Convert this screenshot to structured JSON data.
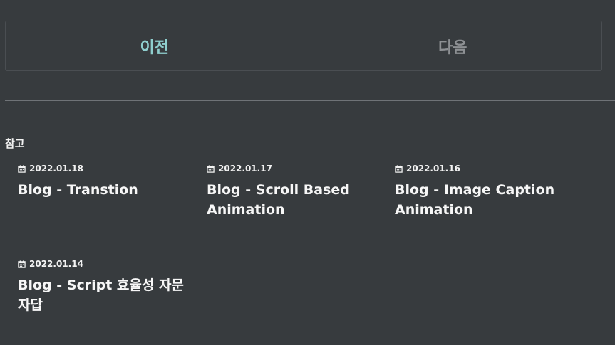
{
  "pager": {
    "prev_label": "이전",
    "next_label": "다음",
    "prev_color": "#8fcfce",
    "next_color": "#8d9093"
  },
  "related": {
    "heading": "참고",
    "icon": "calendar-icon",
    "posts": [
      {
        "date": "2022.01.18",
        "title": "Blog - Transtion"
      },
      {
        "date": "2022.01.17",
        "title": "Blog - Scroll Based Animation"
      },
      {
        "date": "2022.01.16",
        "title": "Blog - Image Caption Animation"
      },
      {
        "date": "2022.01.14",
        "title": "Blog - Script 효율성 자문자답"
      }
    ]
  },
  "colors": {
    "background": "#373b3e",
    "text": "#f2f2f2",
    "border": "#4a4e52"
  }
}
